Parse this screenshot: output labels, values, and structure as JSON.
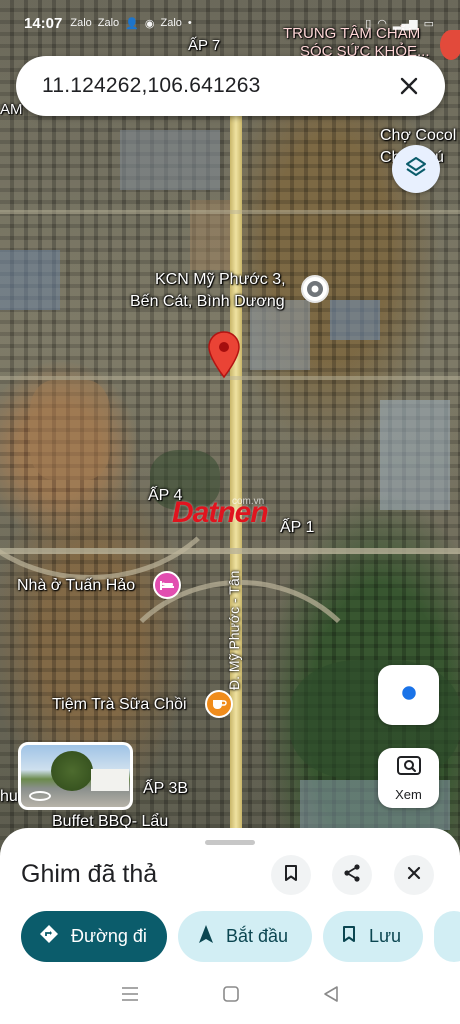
{
  "status_bar": {
    "time": "14:07",
    "icons": [
      "zalo-icon",
      "zalo-icon",
      "person-icon",
      "location-icon",
      "zalo-icon",
      "dot"
    ],
    "right_icons": [
      "vibrate-icon",
      "wifi-icon",
      "signal-icon",
      "battery-icon"
    ]
  },
  "search": {
    "query": "11.124262,106.641263",
    "close_icon": "close-icon"
  },
  "map": {
    "labels": {
      "ap7": "ẤP 7",
      "center_top": "TRUNG TÂM CHĂM",
      "center_bottom": "SÓC SỨC KHỎE...",
      "left_edge": "AM",
      "market_top": "Chợ Cocol",
      "market_bottom": "Chợ Phú",
      "kcn_line1": "KCN Mỹ Phước 3,",
      "kcn_line2": "Bến Cát, Bình Dương",
      "ap4": "ẤP 4",
      "ap1": "ẤP 1",
      "road": "Đ. Mỹ Phước - Tân",
      "tuan_hao": "Nhà ở Tuấn Hảo",
      "tra_sua": "Tiệm Trà Sữa Chồi",
      "ap3b": "ẤP 3B",
      "buffet": "Buffet BBQ- Lẩu",
      "hu": "hu"
    },
    "watermark": "Datnen",
    "watermark_sub": "com.vn"
  },
  "floating": {
    "layers_icon": "layers-icon",
    "my_location_icon": "my-location-icon",
    "lens_label": "Xem"
  },
  "sheet": {
    "title": "Ghim đã thả",
    "bookmark_icon": "bookmark-icon",
    "share_icon": "share-icon",
    "close_icon": "close-icon",
    "chips": [
      {
        "label": "Đường đi",
        "icon": "directions-icon"
      },
      {
        "label": "Bắt đầu",
        "icon": "navigation-icon"
      },
      {
        "label": "Lưu",
        "icon": "bookmark-icon"
      }
    ]
  },
  "colors": {
    "primary_chip": "#0b5c6b",
    "secondary_chip": "#d2eef4",
    "pin": "#ea4335",
    "location_dot": "#1a73e8",
    "watermark": "#e0141e"
  }
}
